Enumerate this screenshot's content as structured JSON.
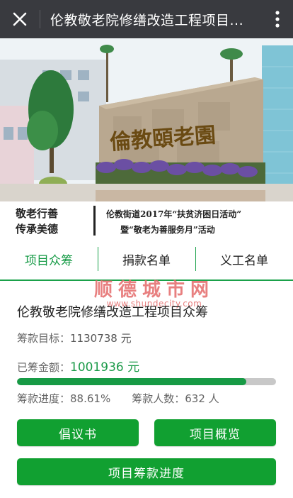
{
  "header": {
    "title": "伦教敬老院修缮改造工程项目...",
    "close_icon": "close-icon",
    "more_icon": "more-vertical-icon",
    "bg_color": "#393a3f"
  },
  "banner": {
    "sign_text": "倫教頤老園",
    "slogan_left_1": "敬老行善",
    "slogan_left_2": "传承美德",
    "slogan_right_1": "伦教街道2017年“扶贫济困日活动”",
    "slogan_right_2": "暨“敬老为善服务月”活动"
  },
  "tabs": [
    {
      "label": "项目众筹",
      "active": true
    },
    {
      "label": "捐款名单",
      "active": false
    },
    {
      "label": "义工名单",
      "active": false
    }
  ],
  "watermark": {
    "name": "顺德城市网",
    "url": "www.shundecity.com"
  },
  "project": {
    "title": "伦教敬老院修缮改造工程项目众筹",
    "goal_label": "筹款目标：",
    "goal_value": "1130738 元",
    "raised_label": "已筹金额：",
    "raised_value": "1001936 元",
    "progress_label": "筹款进度：",
    "progress_value": "88.61%",
    "progress_fraction": 0.8861,
    "donors_label": "筹款人数：",
    "donors_value": "632 人"
  },
  "buttons": {
    "proposal": "倡议书",
    "overview": "项目概览",
    "progress": "项目筹款进度"
  },
  "colors": {
    "accent_green": "#179b47",
    "button_green": "#11a031",
    "watermark_red": "#e46a6a"
  }
}
